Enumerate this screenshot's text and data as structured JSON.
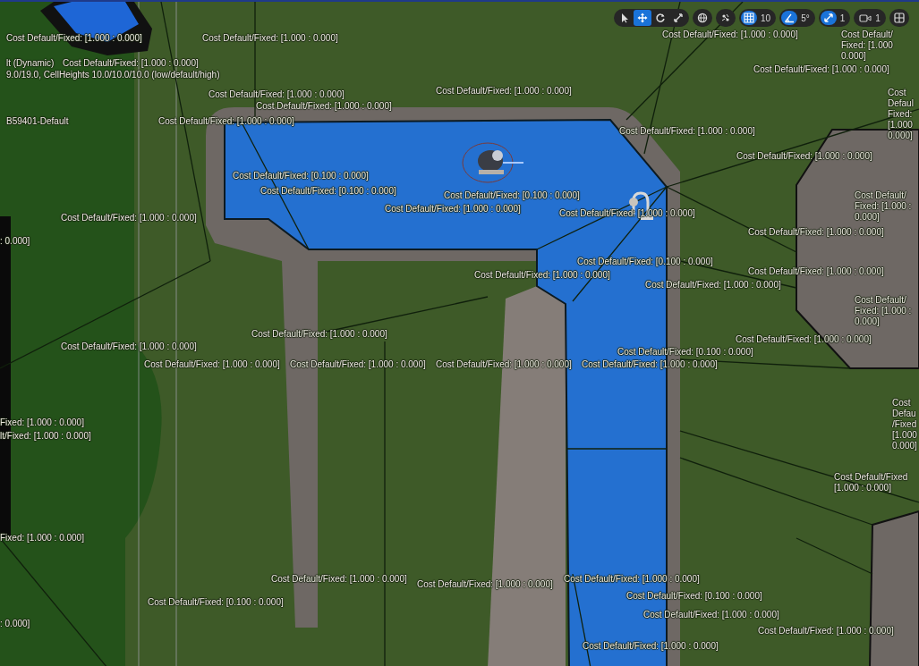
{
  "toolbar": {
    "transform_modes": [
      {
        "kind": "select",
        "selected": false
      },
      {
        "kind": "translate",
        "selected": true
      },
      {
        "kind": "rotate",
        "selected": false
      },
      {
        "kind": "scale",
        "selected": false
      }
    ],
    "buttons": [
      {
        "kind": "world"
      },
      {
        "kind": "surface"
      }
    ],
    "snaps": [
      {
        "kind": "grid",
        "on": true,
        "value": "10"
      },
      {
        "kind": "angle",
        "on": true,
        "value": "5°"
      },
      {
        "kind": "scale",
        "on": true,
        "value": "1"
      }
    ],
    "camera_speed": "1",
    "layout_button": {
      "kind": "layout"
    }
  },
  "labels": [
    {
      "text": "Cost Default/Fixed: [1.000 : 0.000]"
    },
    {
      "text": "Cost Default/Fixed: [1.000 : 0.000]"
    },
    {
      "text": "lt (Dynamic)"
    },
    {
      "text": "Cost Default/Fixed: [1.000 : 0.000]"
    },
    {
      "text": "9.0/19.0, CellHeights 10.0/10.0/10.0 (low/default/high)"
    },
    {
      "text": "B59401-Default"
    },
    {
      "text": "Cost Default/Fixed: [1.000 : 0.000]"
    },
    {
      "text": "Cost Default/Fixed: [1.000 : 0.000]"
    },
    {
      "text": "Cost Default/Fixed: [1.000 : 0.000]"
    },
    {
      "text": "Cost Default/Fixed: [1.000 : 0.000]"
    },
    {
      "text": "Cost Default/Fixed: [1.000 : 0.000]"
    },
    {
      "lines": [
        "Cost",
        "Defaul",
        "Fixed:",
        "[1.000",
        "0.000]"
      ]
    },
    {
      "text": "Cost Default/Fixed: [1.000 : 0.000]"
    },
    {
      "lines": [
        "Cost Default/",
        "Fixed: [1.000",
        "0.000]"
      ]
    },
    {
      "text": "Cost Default/Fixed: [1.000 : 0.000]"
    },
    {
      "text": "Cost Default/Fixed: [1.000 : 0.000]"
    },
    {
      "lines": [
        "Cost Default/",
        "Fixed: [1.000 :",
        "0.000]"
      ]
    },
    {
      "text": "Cost Default/Fixed: [1.000 : 0.000]"
    },
    {
      "text": ": 0.000]"
    },
    {
      "text": "Cost Default/Fixed: [1.000 : 0.000]"
    },
    {
      "text": "Cost Default/Fixed: [0.100 : 0.000]"
    },
    {
      "text": "Cost Default/Fixed: [0.100 : 0.000]"
    },
    {
      "text": "Cost Default/Fixed: [0.100 : 0.000]"
    },
    {
      "text": "Cost Default/Fixed: [1.000 : 0.000]"
    },
    {
      "text": "Cost Default/Fixed: [1.000 : 0.000]"
    },
    {
      "text": "Cost Default/Fixed: [0.100 : 0.000]"
    },
    {
      "text": "Cost Default/Fixed: [1.000 : 0.000]"
    },
    {
      "text": "Cost Default/Fixed: [1.000 : 0.000]"
    },
    {
      "text": "Cost Default/Fixed: [1.000 : 0.000]"
    },
    {
      "lines": [
        "Cost Default/",
        "Fixed: [1.000 :",
        "0.000]"
      ]
    },
    {
      "text": "Cost Default/Fixed: [1.000 : 0.000]"
    },
    {
      "text": "Cost Default/Fixed: [1.000 : 0.000]"
    },
    {
      "text": "Cost Default/Fixed: [1.000 : 0.000]"
    },
    {
      "text": "Cost Default/Fixed: [1.000 : 0.000]"
    },
    {
      "text": "Cost Default/Fixed: [1.000 : 0.000]"
    },
    {
      "text": "Cost Default/Fixed: [1.000 : 0.000]"
    },
    {
      "text": "Cost Default/Fixed: [0.100 : 0.000]"
    },
    {
      "text": "Cost Default/Fixed: [1.000 : 0.000]"
    },
    {
      "text": "Fixed: [1.000 : 0.000]"
    },
    {
      "text": "lt/Fixed: [1.000 : 0.000]"
    },
    {
      "lines": [
        "Cost",
        "Defau",
        "/Fixed",
        "[1.000",
        "0.000]"
      ]
    },
    {
      "lines": [
        "Cost Default/Fixed",
        "[1.000 : 0.000]"
      ]
    },
    {
      "text": "Fixed: [1.000 : 0.000]"
    },
    {
      "text": "Cost Default/Fixed: [1.000 : 0.000]"
    },
    {
      "text": "Cost Default/Fixed: [1.000 : 0.000]"
    },
    {
      "text": "Cost Default/Fixed: [1.000 : 0.000]"
    },
    {
      "text": "Cost Default/Fixed: [0.100 : 0.000]"
    },
    {
      "text": "Cost Default/Fixed: [1.000 : 0.000]"
    },
    {
      "text": "Cost Default/Fixed: [1.000 : 0.000]"
    },
    {
      "text": "Cost Default/Fixed: [0.100 : 0.000]"
    },
    {
      "text": "Cost Default/Fixed: [1.000 : 0.000]"
    },
    {
      "text": ": 0.000]"
    }
  ]
}
